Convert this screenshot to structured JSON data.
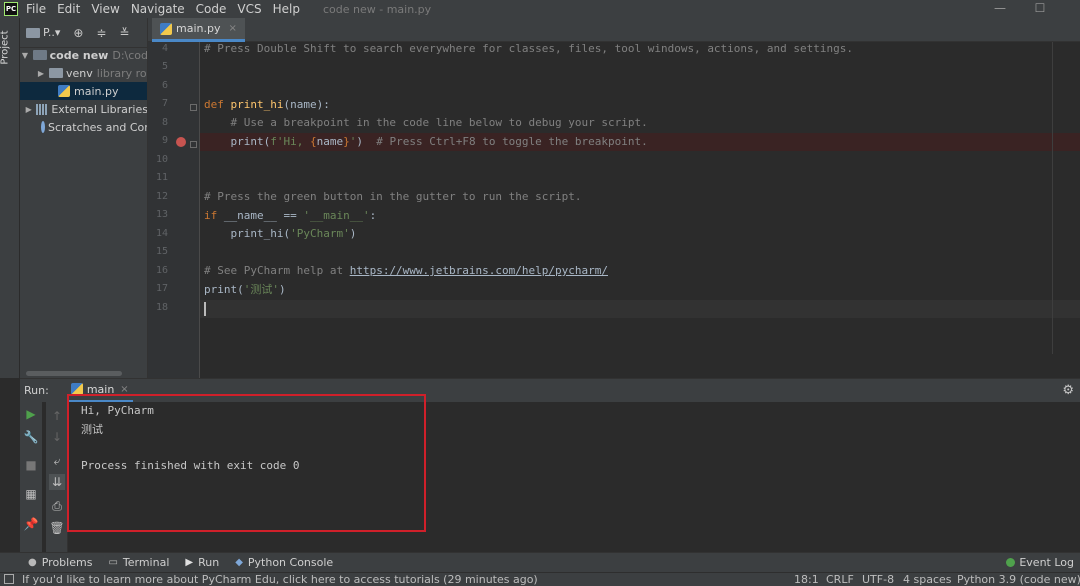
{
  "app": {
    "logo_text": "PC",
    "window_title": "code new - main.py"
  },
  "menu": [
    "File",
    "Edit",
    "View",
    "Navigate",
    "Code",
    "VCS",
    "Help"
  ],
  "left_stripe": {
    "project_label": "Project"
  },
  "project_panel": {
    "selector_label": "P..▾",
    "tree": [
      {
        "label": "code new",
        "hint": "D:\\cod"
      },
      {
        "label": "venv",
        "hint": "library ro"
      },
      {
        "label": "main.py",
        "hint": ""
      },
      {
        "label": "External Libraries",
        "hint": ""
      },
      {
        "label": "Scratches and Cor",
        "hint": ""
      }
    ]
  },
  "editor": {
    "tab_label": "main.py",
    "tab_close": "×",
    "line_numbers": [
      "4",
      "5",
      "6",
      "7",
      "8",
      "9",
      "10",
      "11",
      "12",
      "13",
      "14",
      "15",
      "16",
      "17",
      "18"
    ],
    "code": {
      "l4": "# Press Double Shift to search everywhere for classes, files, tool windows, actions, and settings.",
      "l7_kw": "def ",
      "l7_fn": "print_hi",
      "l7_rest": "(name):",
      "l8": "    # Use a breakpoint in the code line below to debug your script.",
      "l9_a": "    print(",
      "l9_str1": "f'Hi, ",
      "l9_brace_open": "{",
      "l9_name": "name",
      "l9_brace_close": "}",
      "l9_str2": "'",
      "l9_b": ")  ",
      "l9_cm": "# Press Ctrl+F8 to toggle the breakpoint.",
      "l12": "# Press the green button in the gutter to run the script.",
      "l13_kw": "if ",
      "l13_a": "__name__ == ",
      "l13_str": "'__main__'",
      "l13_b": ":",
      "l14_a": "    print_hi(",
      "l14_str": "'PyCharm'",
      "l14_b": ")",
      "l16_cm": "# See PyCharm help at ",
      "l16_link": "https://www.jetbrains.com/help/pycharm/",
      "l17_a": "print(",
      "l17_str": "'测试'",
      "l17_b": ")"
    }
  },
  "run_panel": {
    "label": "Run:",
    "tab_label": "main",
    "tab_close": "×",
    "console": [
      "Hi, PyCharm",
      "测试",
      "",
      "Process finished with exit code 0"
    ]
  },
  "bottom_toolbar": {
    "items": [
      "Problems",
      "Terminal",
      "Run",
      "Python Console"
    ],
    "event_log": "Event Log"
  },
  "status_bar": {
    "message": "If you'd like to learn more about PyCharm Edu, click here to access tutorials (29 minutes ago)",
    "position": "18:1",
    "line_sep": "CRLF",
    "encoding": "UTF-8",
    "indent": "4 spaces",
    "interpreter": "Python 3.9 (code new)"
  },
  "colors": {
    "accent": "#4a88c7",
    "breakpoint": "#c75450",
    "highlight_box": "#d0202a"
  }
}
